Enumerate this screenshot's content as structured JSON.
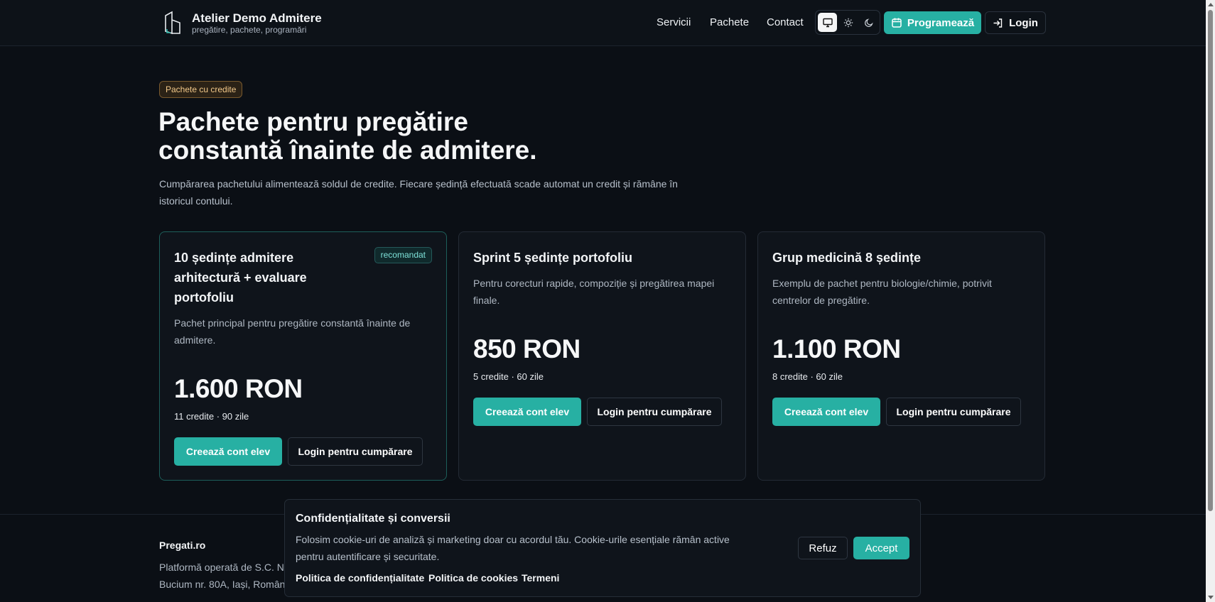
{
  "header": {
    "brand_title": "Atelier Demo Admitere",
    "brand_subtitle": "pregătire, pachete, programări",
    "nav": [
      "Servicii",
      "Pachete",
      "Contact"
    ],
    "program_label": "Programează",
    "login_label": "Login"
  },
  "hero": {
    "badge": "Pachete cu credite",
    "title": "Pachete pentru pregătire constantă înainte de admitere.",
    "description": "Cumpărarea pachetului alimentează soldul de credite. Fiecare ședință efectuată scade automat un credit și rămâne în istoricul contului."
  },
  "packages": [
    {
      "title": "10 ședințe admitere arhitectură + evaluare portofoliu",
      "badge": "recomandat",
      "description": "Pachet principal pentru pregătire constantă înainte de admitere.",
      "price": "1.600 RON",
      "meta": "11 credite · 90 zile",
      "create_label": "Creează cont elev",
      "buy_label": "Login pentru cumpărare"
    },
    {
      "title": "Sprint 5 ședințe portofoliu",
      "description": "Pentru corecturi rapide, compoziție și pregătirea mapei finale.",
      "price": "850 RON",
      "meta": "5 credite · 60 zile",
      "create_label": "Creează cont elev",
      "buy_label": "Login pentru cumpărare"
    },
    {
      "title": "Grup medicină 8 ședințe",
      "description": "Exemplu de pachet pentru biologie/chimie, potrivit centrelor de pregătire.",
      "price": "1.100 RON",
      "meta": "8 credite · 60 zile",
      "create_label": "Creează cont elev",
      "buy_label": "Login pentru cumpărare"
    }
  ],
  "footer": {
    "brand": "Pregati.ro",
    "line1": "Platformă operată de S.C. N",
    "line2": "Bucium nr. 80A, Iași, Român"
  },
  "cookie": {
    "title": "Confidențialitate și conversii",
    "text": "Folosim cookie-uri de analiză și marketing doar cu acordul tău. Cookie-urile esențiale rămân active pentru autentificare și securitate.",
    "links": [
      "Politica de confidențialitate",
      "Politica de cookies",
      "Termeni"
    ],
    "refuse_label": "Refuz",
    "accept_label": "Accept"
  },
  "colors": {
    "accent": "#27b0a3",
    "background": "#0b0f15",
    "badge_text": "#f3c98a"
  }
}
